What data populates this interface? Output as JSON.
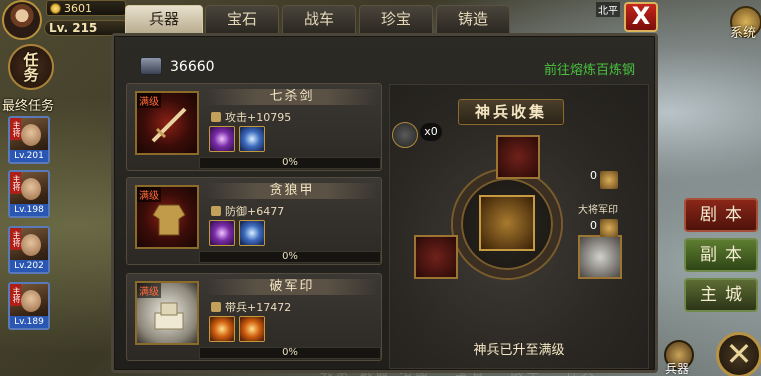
{
  "hud": {
    "gold": "3601",
    "level": "Lv. 215",
    "task_label": "任务",
    "final_task_label": "最终任务",
    "north_label": "北平"
  },
  "generals": [
    {
      "tag": "主将",
      "level": "Lv.201"
    },
    {
      "tag": "主将",
      "level": "Lv.198"
    },
    {
      "tag": "主将",
      "level": "Lv.202"
    },
    {
      "tag": "主将",
      "level": "Lv.189"
    }
  ],
  "tabs": [
    {
      "label": "兵器",
      "active": true
    },
    {
      "label": "宝石",
      "active": false
    },
    {
      "label": "战车",
      "active": false
    },
    {
      "label": "珍宝",
      "active": false
    },
    {
      "label": "铸造",
      "active": false
    }
  ],
  "close_label": "X",
  "resource": {
    "value": "36660",
    "forge_link": "前往熔炼百炼钢"
  },
  "items": [
    {
      "badge": "满级",
      "name": "七杀剑",
      "stat": "攻击+10795",
      "progress_text": "0%",
      "progress": 0
    },
    {
      "badge": "满级",
      "name": "贪狼甲",
      "stat": "防御+6477",
      "progress_text": "0%",
      "progress": 0
    },
    {
      "badge": "满级",
      "name": "破军印",
      "stat": "带兵+17472",
      "progress_text": "0%",
      "progress": 0
    }
  ],
  "collection": {
    "title": "神兵收集",
    "hammer_count": "x0",
    "seal_label": "大将军印",
    "seal_count_top": "0",
    "seal_count_bottom": "0",
    "status": "神兵已升至满级"
  },
  "side_buttons": {
    "story": "剧本",
    "sub": "副本",
    "city": "主城"
  },
  "system_label": "系统",
  "bottom_weapon_label": "兵器",
  "bottom_close": "✕",
  "bottom_bg_text": "玩家 武器 地图 · 宝石 · 战车 · 神兵"
}
